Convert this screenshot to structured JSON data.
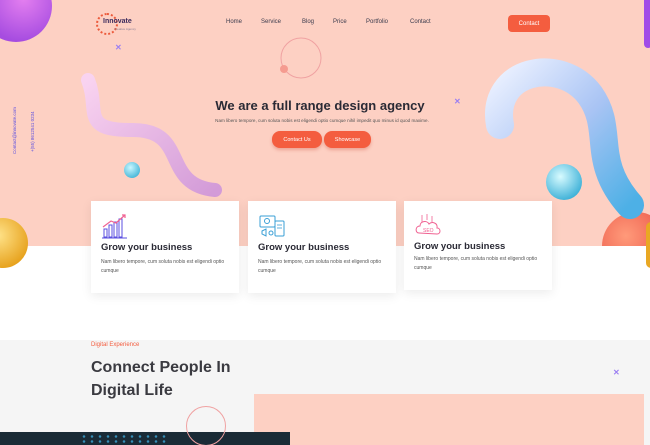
{
  "brand": {
    "name": "Innovate",
    "tagline": "Creative Agency"
  },
  "nav": {
    "items": [
      "Home",
      "Service",
      "Blog",
      "Price",
      "Portfolio",
      "Contact"
    ]
  },
  "header": {
    "contact_button": "Contact"
  },
  "side_links": {
    "email": "Contact@innovate.com",
    "phone": "+(55) 8612541 0234"
  },
  "hero": {
    "title": "We are a full range design agency",
    "subtitle": "Nam libero tempore, cum soluta nobis est eligendi optio cumque nihil impedit quo minus id quod maxime.",
    "primary_button": "Contact Us",
    "secondary_button": "Showcase"
  },
  "cards": [
    {
      "icon": "growth-chart-icon",
      "title": "Grow your business",
      "text": "Nam libero tempore, cum soluta nobis est eligendi optio cumque"
    },
    {
      "icon": "marketing-tools-icon",
      "title": "Grow your business",
      "text": "Nam libero tempore, cum soluta nobis est eligendi optio cumque"
    },
    {
      "icon": "seo-icon",
      "title": "Grow your business",
      "text": "Nam libero tempore, cum soluta nobis est eligendi optio cumque"
    }
  ],
  "section2": {
    "eyebrow": "Digital Experience",
    "title_line1": "Connect People In",
    "title_line2": "Digital Life"
  },
  "colors": {
    "accent": "#f45d3f",
    "hero_bg": "#fdd0c3",
    "decor_x": "#9a7ef2"
  }
}
